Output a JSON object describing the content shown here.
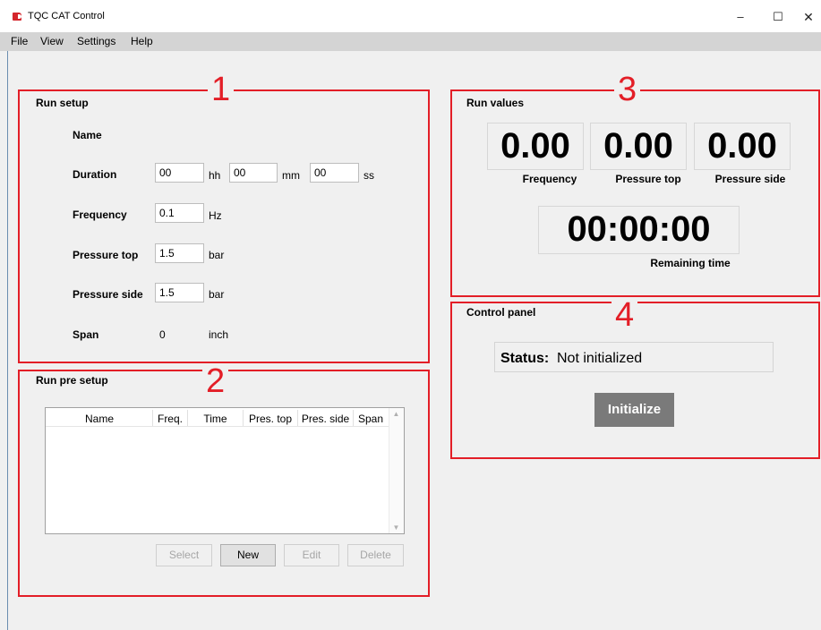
{
  "window": {
    "title": "TQC CAT Control",
    "min_glyph": "–",
    "max_glyph": "☐",
    "close_glyph": "✕"
  },
  "menu": [
    "File",
    "View",
    "Settings",
    "Help"
  ],
  "annotations": [
    "1",
    "2",
    "3",
    "4"
  ],
  "run_setup": {
    "title": "Run setup",
    "name_label": "Name",
    "duration_label": "Duration",
    "duration": {
      "hh": "00",
      "hh_unit": "hh",
      "mm": "00",
      "mm_unit": "mm",
      "ss": "00",
      "ss_unit": "ss"
    },
    "frequency_label": "Frequency",
    "frequency_value": "0.1",
    "frequency_unit": "Hz",
    "pressure_top_label": "Pressure top",
    "pressure_top_value": "1.5",
    "pressure_top_unit": "bar",
    "pressure_side_label": "Pressure side",
    "pressure_side_value": "1.5",
    "pressure_side_unit": "bar",
    "span_label": "Span",
    "span_value": "0",
    "span_unit": "inch"
  },
  "run_pre_setup": {
    "title": "Run pre setup",
    "columns": [
      "Name",
      "Freq.",
      "Time",
      "Pres. top",
      "Pres. side",
      "Span"
    ],
    "rows": [],
    "buttons": {
      "select": "Select",
      "new": "New",
      "edit": "Edit",
      "delete": "Delete"
    }
  },
  "run_values": {
    "title": "Run values",
    "frequency_value": "0.00",
    "frequency_label": "Frequency",
    "pressure_top_value": "0.00",
    "pressure_top_label": "Pressure top",
    "pressure_side_value": "0.00",
    "pressure_side_label": "Pressure side",
    "remaining_time_value": "00:00:00",
    "remaining_time_label": "Remaining time"
  },
  "control_panel": {
    "title": "Control panel",
    "status_label": "Status:",
    "status_value": "Not initialized",
    "initialize_button": "Initialize"
  },
  "colors": {
    "annotation": "#e31e27",
    "initialize_bg": "#7a7a7a",
    "menubar": "#d4d4d4"
  }
}
